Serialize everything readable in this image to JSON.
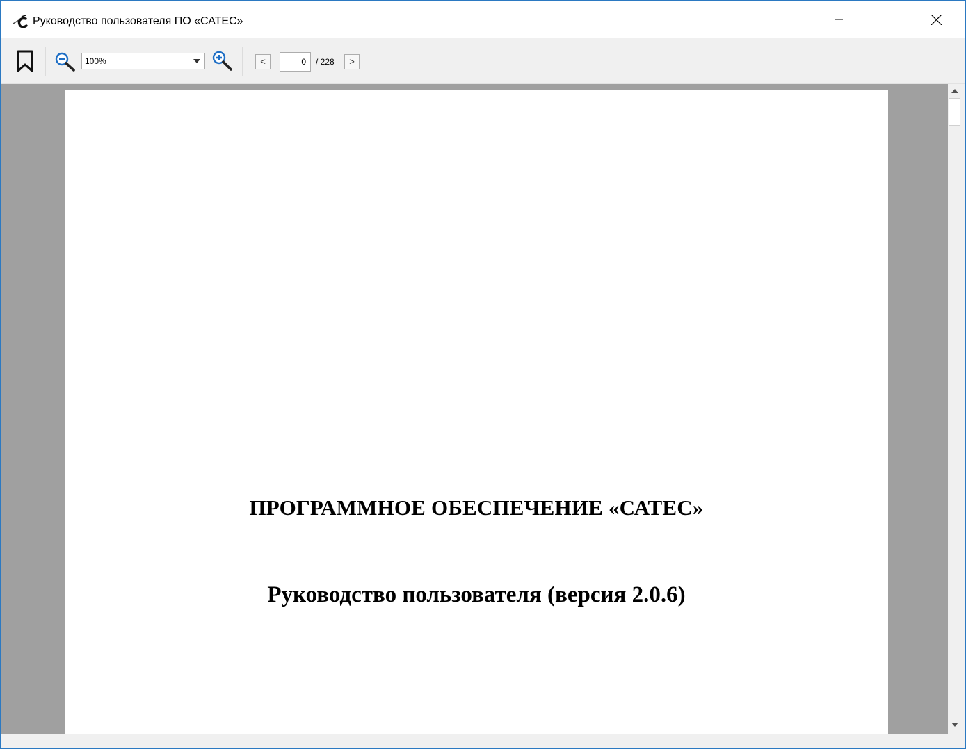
{
  "window": {
    "title": "Руководство пользователя ПО «САТЕС»",
    "icon": "app-logo-icon",
    "controls": [
      "minimize-icon",
      "maximize-icon",
      "close-icon"
    ]
  },
  "toolbar": {
    "bookmarks_icon": "bookmark-icon",
    "zoom_out_icon": "zoom-out-icon",
    "zoom_value": "100%",
    "zoom_in_icon": "zoom-in-icon",
    "prev_label": "<",
    "page_current": "0",
    "page_total": "/ 228",
    "next_label": ">"
  },
  "document": {
    "heading": "ПРОГРАММНОЕ ОБЕСПЕЧЕНИЕ «САТЕС»",
    "subtitle": "Руководство пользователя (версия 2.0.6)"
  },
  "colors": {
    "viewport_background": "#a0a0a0",
    "page_background": "#ffffff",
    "window_border": "#2b79c2",
    "zoom_icon_accent": "#1f6fc5"
  }
}
